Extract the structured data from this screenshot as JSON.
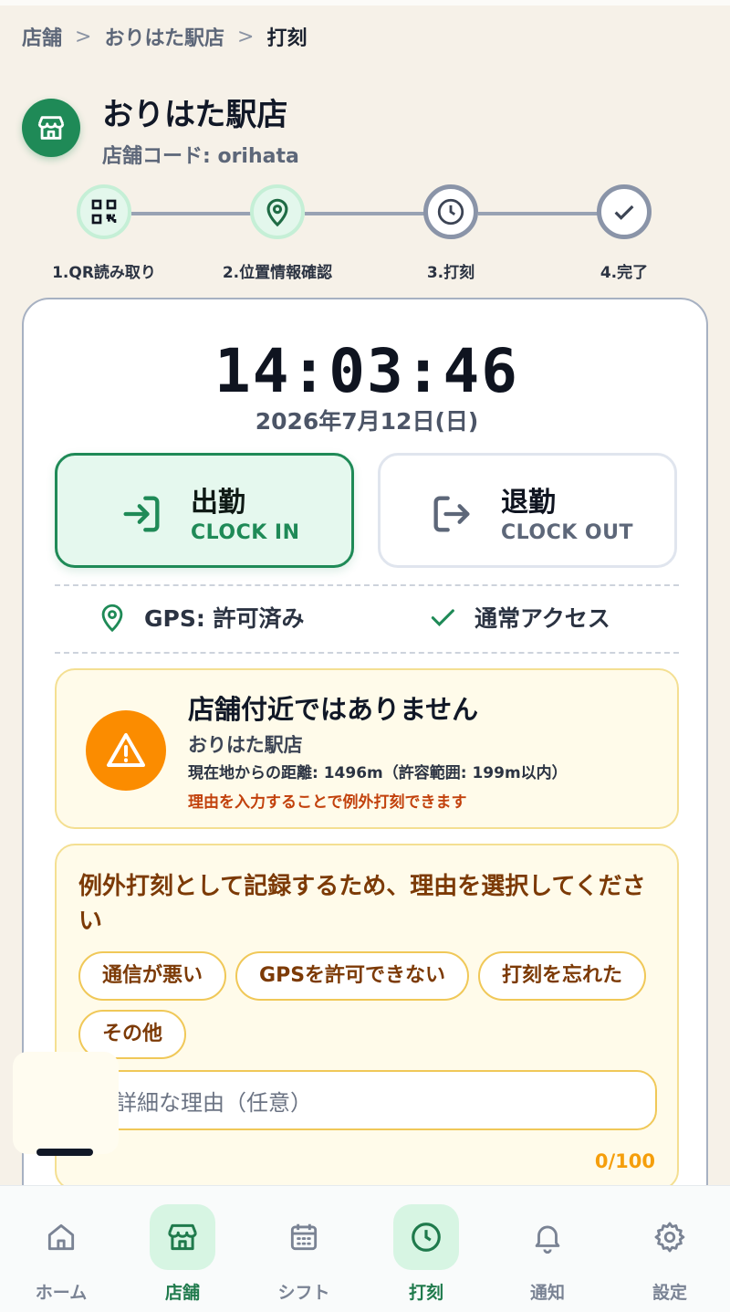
{
  "breadcrumb": {
    "item1": "店舗",
    "item2": "おりはた駅店",
    "current": "打刻",
    "separator": ">"
  },
  "store": {
    "name": "おりはた駅店",
    "code_label": "店舗コード: orihata",
    "icon": "store-icon"
  },
  "steps": [
    {
      "label": "1.QR読み取り",
      "state": "done",
      "icon": "qr-code-icon"
    },
    {
      "label": "2.位置情報確認",
      "state": "done",
      "icon": "map-pin-icon"
    },
    {
      "label": "3.打刻",
      "state": "todo",
      "icon": "clock-icon"
    },
    {
      "label": "4.完了",
      "state": "todo",
      "icon": "check-icon"
    }
  ],
  "clock": {
    "time": "14:03:46",
    "date": "2026年7月12日(日)"
  },
  "actions": {
    "clock_in": {
      "title": "出勤",
      "sub": "CLOCK IN"
    },
    "clock_out": {
      "title": "退勤",
      "sub": "CLOCK OUT"
    }
  },
  "status": {
    "gps": "GPS: 許可済み",
    "access": "通常アクセス"
  },
  "warning": {
    "title": "店舗付近ではありません",
    "store": "おりはた駅店",
    "distance": "現在地からの距離: 1496m（許容範囲: 199m以内）",
    "hint": "理由を入力することで例外打刻できます"
  },
  "reason": {
    "title": "例外打刻として記録するため、理由を選択してください",
    "chips": [
      "通信が悪い",
      "GPSを許可できない",
      "打刻を忘れた",
      "その他"
    ],
    "placeholder": "詳細な理由（任意）",
    "counter": "0/100"
  },
  "nav": [
    {
      "label": "ホーム",
      "icon": "home-icon",
      "active": false
    },
    {
      "label": "店舗",
      "icon": "store-icon",
      "active": true
    },
    {
      "label": "シフト",
      "icon": "calendar-icon",
      "active": false
    },
    {
      "label": "打刻",
      "icon": "clock-icon",
      "active": true
    },
    {
      "label": "通知",
      "icon": "bell-icon",
      "active": false
    },
    {
      "label": "設定",
      "icon": "gear-icon",
      "active": false
    }
  ],
  "colors": {
    "accent": "#1f8a57",
    "warning": "#fb8c00",
    "reason_text": "#7c3a06"
  }
}
